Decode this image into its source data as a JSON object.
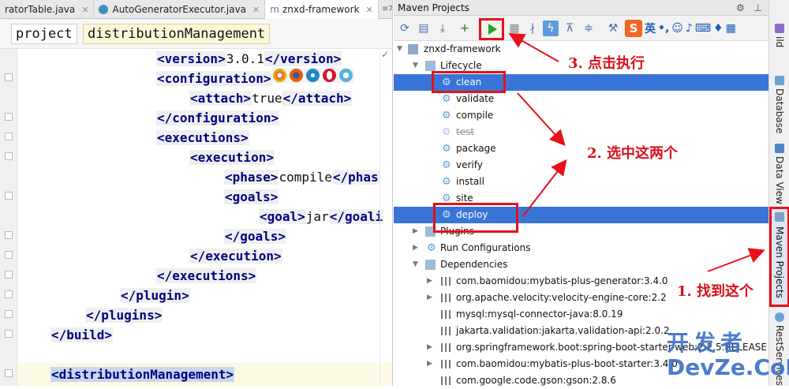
{
  "editor": {
    "tabs": [
      {
        "label": "ratorTable.java",
        "close": "✕"
      },
      {
        "label": "AutoGeneratorExecutor.java",
        "close": "✕"
      },
      {
        "label": "znxd-framework",
        "close": "✕",
        "mark": "m"
      }
    ],
    "tab_overflow": "≡7",
    "breadcrumbs": [
      "project",
      "distributionManagement"
    ],
    "code_lines": [
      {
        "open": "<version>",
        "text": "3.0.1",
        "close": "</version>"
      },
      {
        "open": "<configuration>",
        "text": "",
        "close": ""
      },
      {
        "open": "<attach>",
        "text": "true",
        "close": "</attach>"
      },
      {
        "open": "</configuration>",
        "text": "",
        "close": ""
      },
      {
        "open": "<executions>",
        "text": "",
        "close": ""
      },
      {
        "open": "<execution>",
        "text": "",
        "close": ""
      },
      {
        "open": "<phase>",
        "text": "compile",
        "close": "</phas"
      },
      {
        "open": "<goals>",
        "text": "",
        "close": ""
      },
      {
        "open": "<goal>",
        "text": "jar",
        "close": "</goali"
      },
      {
        "open": "</goals>",
        "text": "",
        "close": ""
      },
      {
        "open": "</execution>",
        "text": "",
        "close": ""
      },
      {
        "open": "</executions>",
        "text": "",
        "close": ""
      },
      {
        "open": "</plugin>",
        "text": "",
        "close": ""
      },
      {
        "open": "</plugins>",
        "text": "",
        "close": ""
      },
      {
        "open": "</build>",
        "text": "",
        "close": ""
      },
      {
        "open": "",
        "text": "",
        "close": ""
      },
      {
        "open": "<distributionManagement>",
        "text": "",
        "close": ""
      }
    ]
  },
  "maven": {
    "title": "Maven Projects",
    "header_icons": "⚙ ⊥",
    "ime": {
      "s": "S",
      "lang": "英",
      "punct": "•,"
    },
    "project": "znxd-framework",
    "lifecycle_label": "Lifecycle",
    "lifecycle": [
      {
        "label": "clean",
        "selected": true
      },
      {
        "label": "validate",
        "selected": false
      },
      {
        "label": "compile",
        "selected": false
      },
      {
        "label": "test",
        "selected": false,
        "skipped": true
      },
      {
        "label": "package",
        "selected": false
      },
      {
        "label": "verify",
        "selected": false
      },
      {
        "label": "install",
        "selected": false
      },
      {
        "label": "site",
        "selected": false
      },
      {
        "label": "deploy",
        "selected": true
      }
    ],
    "plugins_label": "Plugins",
    "run_configurations_label": "Run Configurations",
    "dependencies_label": "Dependencies",
    "dependencies": [
      "com.baomidou:mybatis-plus-generator:3.4.0",
      "org.apache.velocity:velocity-engine-core:2.2",
      "mysql:mysql-connector-java:8.0.19",
      "jakarta.validation:jakarta.validation-api:2.0.2",
      "org.springframework.boot:spring-boot-starter-web:2.2.5.RELEASE",
      "com.baomidou:mybatis-plus-boot-starter:3.4.0",
      "com.google.code.gson:gson:2.8.6"
    ]
  },
  "side_strip": {
    "build": "ild",
    "database": "Database",
    "data_view": "Data View",
    "maven_projects": "Maven Projects",
    "rest_services": "RestServices"
  },
  "annotations": {
    "step1": "1. 找到这个",
    "step2": "2. 选中这两个",
    "step3": "3. 点击执行"
  },
  "watermark": {
    "cn": "开发者",
    "en": "DevZe.CoM"
  },
  "colors": {
    "annotation_red": "#e8101a",
    "selection_blue": "#3875d7",
    "run_green": "#2aa12a"
  }
}
